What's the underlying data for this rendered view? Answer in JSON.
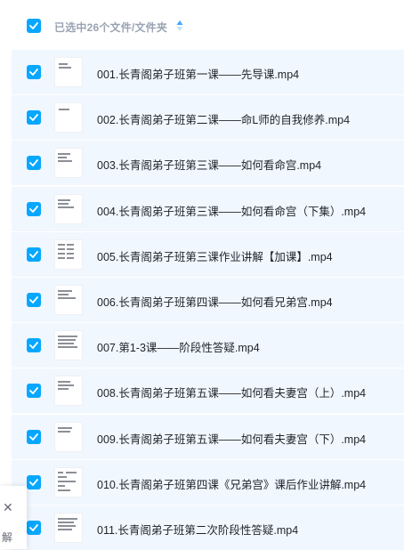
{
  "header": {
    "selection_label": "已选中26个文件/文件夹",
    "sort_icon": "sort-arrows-icon"
  },
  "colors": {
    "accent": "#06a7ff",
    "row_bg": "#f0f7ff",
    "header_text": "#9aa3b3",
    "file_text": "#1f2329"
  },
  "files": [
    {
      "name": "001.长青阁弟子班第一课——先导课.mp4",
      "checked": true
    },
    {
      "name": "002.长青阁弟子班第二课——命L师的自我修养.mp4",
      "checked": true
    },
    {
      "name": "003.长青阁弟子班第三课——如何看命宫.mp4",
      "checked": true
    },
    {
      "name": "004.长青阁弟子班第三课——如何看命宫（下集）.mp4",
      "checked": true
    },
    {
      "name": "005.长青阁弟子班第三课作业讲解【加课】.mp4",
      "checked": true
    },
    {
      "name": "006.长青阁弟子班第四课——如何看兄弟宫.mp4",
      "checked": true
    },
    {
      "name": "007.第1-3课——阶段性答疑.mp4",
      "checked": true
    },
    {
      "name": "008.长青阁弟子班第五课——如何看夫妻宫（上）.mp4",
      "checked": true
    },
    {
      "name": "009.长青阁弟子班第五课——如何看夫妻宫（下）.mp4",
      "checked": true
    },
    {
      "name": "010.长青阁弟子班第四课《兄弟宫》课后作业讲解.mp4",
      "checked": true
    },
    {
      "name": "011.长青阁弟子班第二次阶段性答疑.mp4",
      "checked": true
    }
  ],
  "side_popup": {
    "close_icon": "close-icon",
    "label": "解"
  }
}
